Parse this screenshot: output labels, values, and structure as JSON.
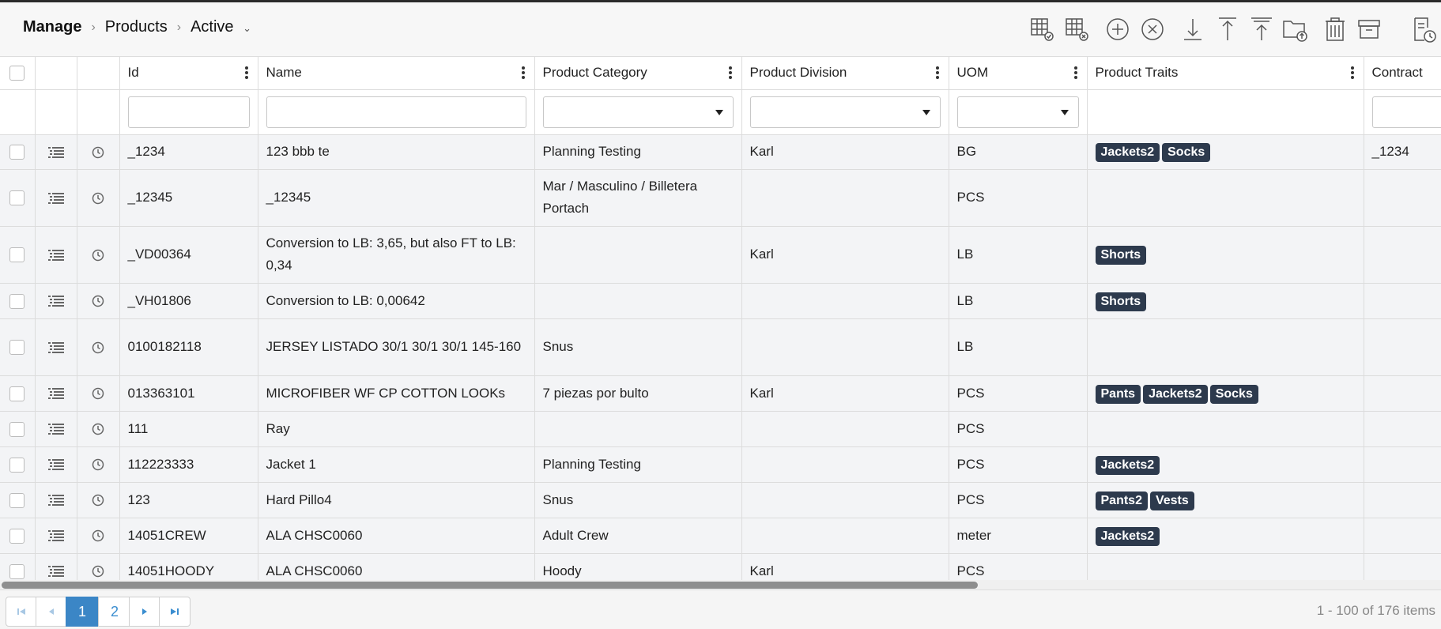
{
  "breadcrumb": {
    "root": "Manage",
    "section": "Products",
    "view": "Active"
  },
  "toolbar": {
    "icons": [
      "grid-check-icon",
      "grid-remove-icon",
      "add-circle-icon",
      "cancel-circle-icon",
      "download-icon",
      "upload-icon",
      "upload-top-icon",
      "folder-upload-icon",
      "trash-icon",
      "archive-icon",
      "report-history-icon"
    ]
  },
  "columns": {
    "id": "Id",
    "name": "Name",
    "category": "Product Category",
    "division": "Product Division",
    "uom": "UOM",
    "traits": "Product Traits",
    "contract": "Contract"
  },
  "rows": [
    {
      "id": "_1234",
      "name": "123 bbb te",
      "category": "Planning Testing",
      "division": "Karl",
      "uom": "BG",
      "traits": [
        "Jackets2",
        "Socks"
      ],
      "contract": "_1234"
    },
    {
      "id": "_12345",
      "name": "_12345",
      "category": "Mar / Masculino / Billetera Portach",
      "division": "",
      "uom": "PCS",
      "traits": [],
      "contract": ""
    },
    {
      "id": "_VD00364",
      "name": "Conversion to LB: 3,65, but also FT to LB: 0,34",
      "category": "",
      "division": "Karl",
      "uom": "LB",
      "traits": [
        "Shorts"
      ],
      "contract": ""
    },
    {
      "id": "_VH01806",
      "name": "Conversion to LB: 0,00642",
      "category": "",
      "division": "",
      "uom": "LB",
      "traits": [
        "Shorts"
      ],
      "contract": ""
    },
    {
      "id": "0100182118",
      "name": "JERSEY LISTADO 30/1 30/1 30/1 145-160",
      "category": "Snus",
      "division": "",
      "uom": "LB",
      "traits": [],
      "contract": ""
    },
    {
      "id": "013363101",
      "name": "MICROFIBER WF CP COTTON LOOKs",
      "category": "7 piezas por bulto",
      "division": "Karl",
      "uom": "PCS",
      "traits": [
        "Pants",
        "Jackets2",
        "Socks"
      ],
      "contract": ""
    },
    {
      "id": "111",
      "name": "Ray",
      "category": "",
      "division": "",
      "uom": "PCS",
      "traits": [],
      "contract": ""
    },
    {
      "id": "112223333",
      "name": "Jacket 1",
      "category": "Planning Testing",
      "division": "",
      "uom": "PCS",
      "traits": [
        "Jackets2"
      ],
      "contract": ""
    },
    {
      "id": "123",
      "name": "Hard Pillo4",
      "category": "Snus",
      "division": "",
      "uom": "PCS",
      "traits": [
        "Pants2",
        "Vests"
      ],
      "contract": ""
    },
    {
      "id": "14051CREW",
      "name": "ALA CHSC0060",
      "category": "Adult Crew",
      "division": "",
      "uom": "meter",
      "traits": [
        "Jackets2"
      ],
      "contract": ""
    },
    {
      "id": "14051HOODY",
      "name": "ALA CHSC0060",
      "category": "Hoody",
      "division": "Karl",
      "uom": "PCS",
      "traits": [],
      "contract": ""
    }
  ],
  "pager": {
    "pages": [
      "1",
      "2"
    ],
    "current": "1",
    "info": "1 - 100 of 176 items"
  },
  "colors": {
    "tag": "#2d3a4d",
    "pager_active": "#3b86c6",
    "row_bg": "#f3f4f6"
  }
}
